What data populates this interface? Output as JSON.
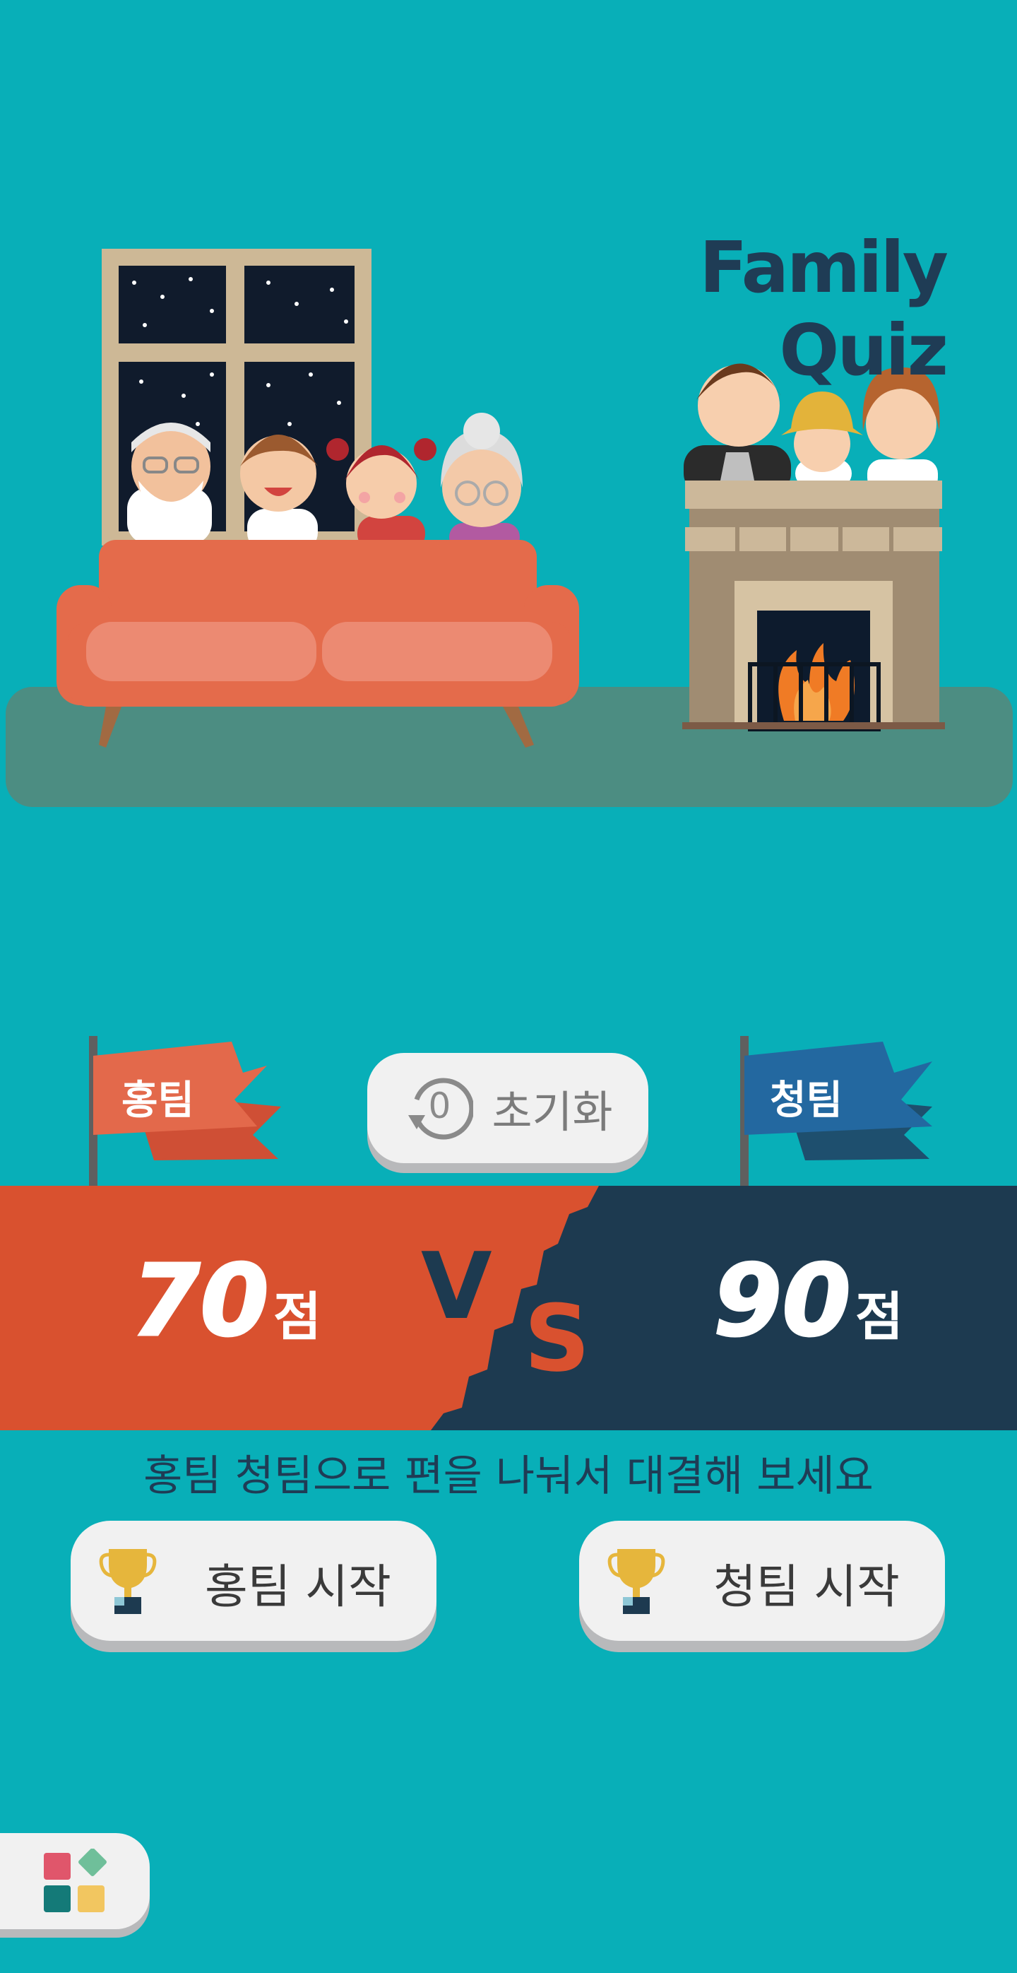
{
  "app": {
    "title": "Family Quiz"
  },
  "reset": {
    "label": "초기화",
    "icon": "reset-icon",
    "icon_glyph": "0"
  },
  "teams": {
    "red": {
      "name": "홍팀",
      "score": "70",
      "unit": "점",
      "color": "#d9512f",
      "start_label": "홍팀 시작"
    },
    "blue": {
      "name": "청팀",
      "score": "90",
      "unit": "점",
      "color": "#1d3a50",
      "start_label": "청팀 시작"
    }
  },
  "versus": {
    "v": "V",
    "s": "S"
  },
  "instruction": "홍팀 청팀으로 편을 나눠서 대결해 보세요",
  "menu": {
    "icon": "apps-icon"
  },
  "colors": {
    "background": "#08afb8",
    "title": "#1f3c55",
    "button": "#f1f1f1"
  }
}
